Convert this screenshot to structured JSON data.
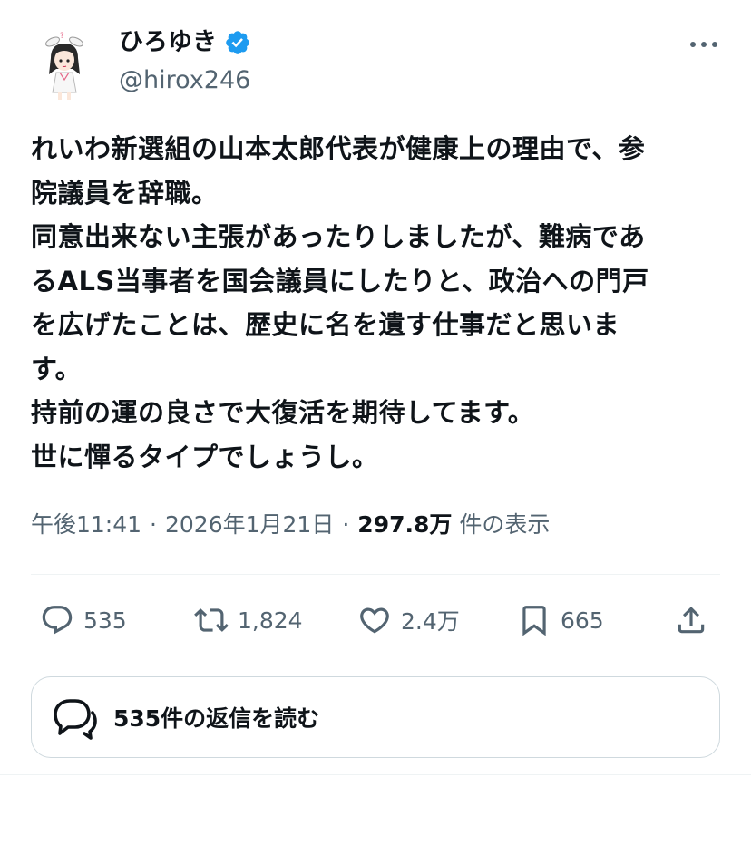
{
  "author": {
    "name": "ひろゆき",
    "handle": "@hirox246",
    "verified": true
  },
  "post": {
    "text": "れいわ新選組の山本太郎代表が健康上の理由で、参\n院議員を辞職。\n同意出来ない主張があったりしましたが、難病であ\nるALS当事者を国会議員にしたりと、政治への門戸\nを広げたことは、歴史に名を遺す仕事だと思いま\nす。\n持前の運の良さで大復活を期待してます。\n世に憚るタイプでしょうし。"
  },
  "meta": {
    "time": "午後11:41",
    "separator": "·",
    "date": "2026年1月21日",
    "views_count": "297.8万",
    "views_label": "件の表示"
  },
  "actions": {
    "replies": "535",
    "reposts": "1,824",
    "likes": "2.4万",
    "bookmarks": "665"
  },
  "read_replies": {
    "label": "535件の返信を読む"
  },
  "colors": {
    "text": "#0f1419",
    "secondary": "#536471",
    "verified": "#1d9bf0",
    "border": "#cfd9de"
  },
  "icons": [
    "more-icon",
    "verified-badge-icon",
    "reply-icon",
    "repost-icon",
    "like-icon",
    "bookmark-icon",
    "share-icon",
    "conversation-icon"
  ]
}
